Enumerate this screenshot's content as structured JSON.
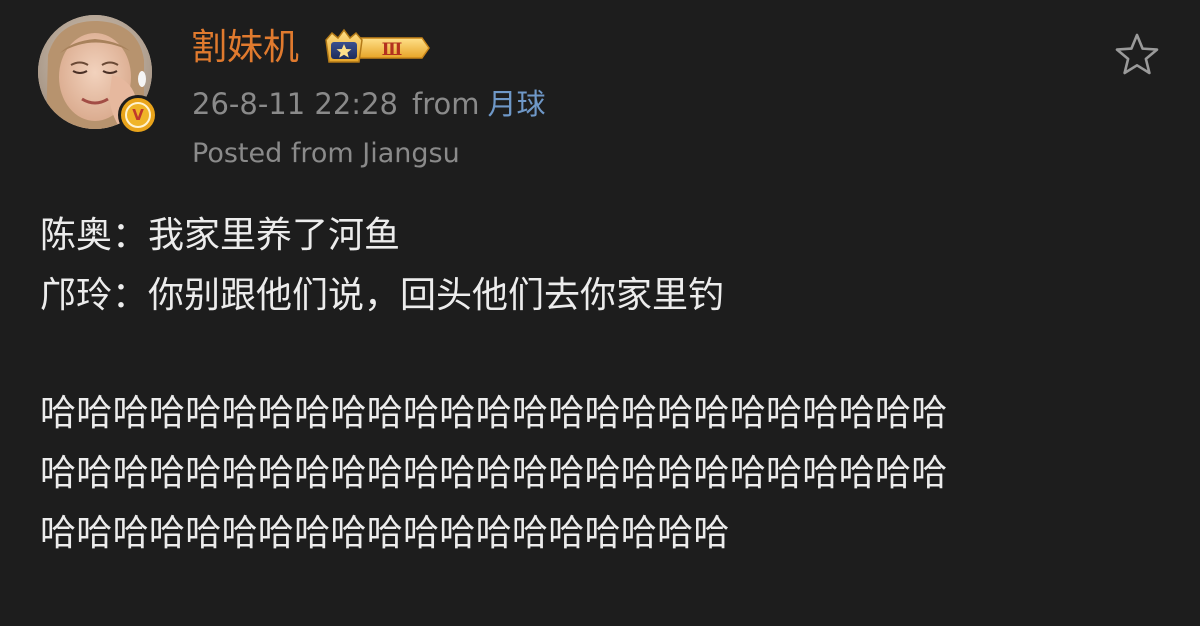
{
  "post": {
    "author": {
      "name": "割妹机",
      "vip_level": "Ⅲ",
      "verified_mark": "V"
    },
    "timestamp": "26-8-11 22:28",
    "from_label": "from",
    "source": "月球",
    "location": "Posted from Jiangsu",
    "icons": {
      "favorite": "star-outline-icon",
      "verified": "verified-v-icon",
      "vip": "crown-vip-badge"
    },
    "body": {
      "lines": [
        "陈奥：我家里养了河鱼",
        "邝玲：你别跟他们说，回头他们去你家里钓"
      ],
      "laugh_lines": [
        "哈哈哈哈哈哈哈哈哈哈哈哈哈哈哈哈哈哈哈哈哈哈哈哈哈",
        "哈哈哈哈哈哈哈哈哈哈哈哈哈哈哈哈哈哈哈哈哈哈哈哈哈",
        "哈哈哈哈哈哈哈哈哈哈哈哈哈哈哈哈哈哈哈"
      ]
    },
    "colors": {
      "background": "#1d1d1d",
      "username": "#e07a2e",
      "meta": "#8a8a8a",
      "source_link": "#6f98c8",
      "text": "#ececec"
    }
  }
}
